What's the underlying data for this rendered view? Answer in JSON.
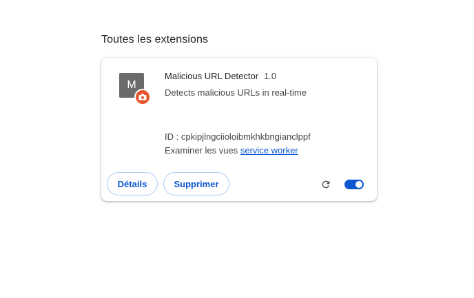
{
  "section": {
    "title": "Toutes les extensions"
  },
  "extension": {
    "icon_letter": "M",
    "badge_icon": "camera-icon",
    "name": "Malicious URL Detector",
    "version": "1.0",
    "description": "Detects malicious URLs in real-time",
    "id_text": "ID : cpkipjlngciioloibmkhkbngianclppf",
    "inspect_label": "Examiner les vues",
    "inspect_link": "service worker",
    "details_button": "Détails",
    "remove_button": "Supprimer",
    "reload_icon": "reload-icon",
    "enabled": true
  },
  "colors": {
    "accent": "#0b57d0",
    "badge": "#e8552e",
    "icon_bg": "#6b6b6b"
  }
}
